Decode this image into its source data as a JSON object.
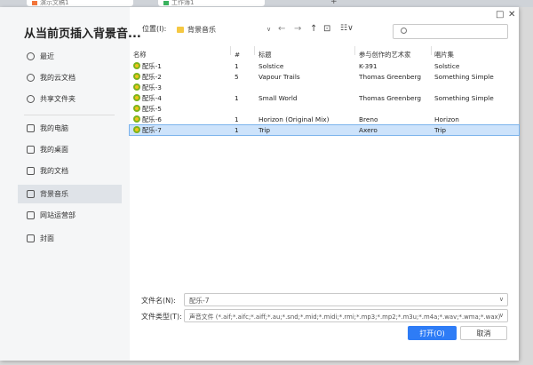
{
  "browser_tabs": [
    {
      "label": "演示文稿1",
      "color": "#f3753a"
    },
    {
      "label": "工作簿1",
      "color": "#3ab35e"
    }
  ],
  "dialog": {
    "title": "从当前页插入背景音...",
    "window_controls": [
      "□",
      "✕"
    ]
  },
  "sidebar": {
    "items": [
      {
        "label": "最近",
        "icon": "clock-icon"
      },
      {
        "label": "我的云文档",
        "icon": "cloud-icon"
      },
      {
        "label": "共享文件夹",
        "icon": "share-icon"
      },
      {
        "label": "我的电脑",
        "icon": "computer-icon"
      },
      {
        "label": "我的桌面",
        "icon": "desktop-icon"
      },
      {
        "label": "我的文档",
        "icon": "folder-icon"
      },
      {
        "label": "背景音乐",
        "icon": "folder-icon",
        "active": true
      },
      {
        "label": "网站运营部",
        "icon": "folder-icon"
      },
      {
        "label": "封面",
        "icon": "folder-icon"
      }
    ]
  },
  "toolbar": {
    "location_label": "位置(I):",
    "current_folder": "背景音乐",
    "search_placeholder": ""
  },
  "table": {
    "headers": [
      "名称",
      "#",
      "标题",
      "参与创作的艺术家",
      "唱片集"
    ],
    "rows": [
      {
        "name": "配乐-1",
        "num": "1",
        "title": "Solstice",
        "artist": "K-391",
        "album": "Solstice"
      },
      {
        "name": "配乐-2",
        "num": "5",
        "title": "Vapour Trails",
        "artist": "Thomas Greenberg",
        "album": "Something Simple"
      },
      {
        "name": "配乐-3",
        "num": "",
        "title": "",
        "artist": "",
        "album": ""
      },
      {
        "name": "配乐-4",
        "num": "1",
        "title": "Small World",
        "artist": "Thomas Greenberg",
        "album": "Something Simple"
      },
      {
        "name": "配乐-5",
        "num": "",
        "title": "",
        "artist": "",
        "album": ""
      },
      {
        "name": "配乐-6",
        "num": "1",
        "title": "Horizon (Original Mix)",
        "artist": "Breno",
        "album": "Horizon"
      },
      {
        "name": "配乐-7",
        "num": "1",
        "title": "Trip",
        "artist": "Axero",
        "album": "Trip",
        "selected": true
      }
    ]
  },
  "bottom": {
    "filename_label": "文件名(N):",
    "filename_value": "配乐-7",
    "filetype_label": "文件类型(T):",
    "filetype_value": "声音文件 (*.aif;*.aifc;*.aiff;*.au;*.snd;*.mid;*.midi;*.rmi;*.mp3;*.mp2;*.m3u;*.m4a;*.wav;*.wma;*.wax)",
    "open_label": "打开(O)",
    "cancel_label": "取消"
  },
  "colors": {
    "accent": "#2e7cf6",
    "selection": "#cde3fb"
  }
}
